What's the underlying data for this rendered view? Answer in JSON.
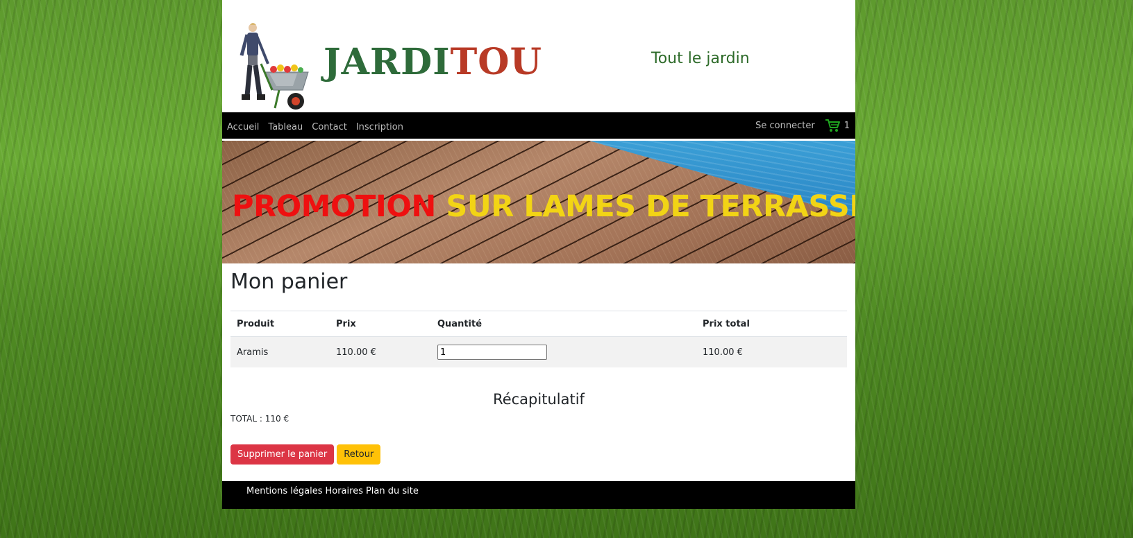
{
  "brand": {
    "logo_part1": "JARDI",
    "logo_part2": "TOU",
    "tagline": "Tout le jardin"
  },
  "nav": {
    "links": [
      {
        "label": "Accueil"
      },
      {
        "label": "Tableau"
      },
      {
        "label": "Contact"
      },
      {
        "label": "Inscription"
      }
    ],
    "login_label": "Se connecter",
    "cart_count": "1",
    "cart_icon": "shopping-cart-icon",
    "cart_icon_color": "#1fa51f"
  },
  "banner": {
    "text_red": "PROMOTION",
    "text_yellow": "SUR LAMES DE TERRASSE"
  },
  "cart": {
    "title": "Mon panier",
    "columns": [
      "Produit",
      "Prix",
      "Quantité",
      "Prix total"
    ],
    "rows": [
      {
        "product": "Aramis",
        "price": "110.00 €",
        "quantity": "1",
        "total": "110.00 €"
      }
    ]
  },
  "summary": {
    "title": "Récapitulatif",
    "total": "TOTAL : 110 €"
  },
  "actions": {
    "delete_label": "Supprimer le panier",
    "back_label": "Retour"
  },
  "footer": {
    "links": [
      "Mentions légales",
      "Horaires",
      "Plan du site"
    ]
  },
  "colors": {
    "danger": "#dc3545",
    "warning": "#ffc107",
    "logo_green": "#2e6b3a",
    "logo_red": "#b83a26"
  }
}
